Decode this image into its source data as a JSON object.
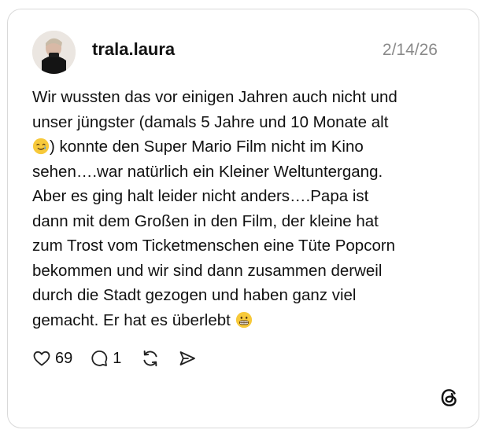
{
  "post": {
    "username": "trala.laura",
    "date": "2/14/26",
    "lines": [
      "Wir wussten das vor einigen Jahren auch nicht und",
      "unser jüngster (damals 5 Jahre und 10 Monate alt",
      ") konnte den Super Mario Film nicht im Kino",
      "sehen….war natürlich ein Kleiner Weltuntergang.",
      "Aber es ging halt leider nicht anders….Papa ist",
      "dann mit dem Großen in den Film, der kleine hat",
      "zum Trost vom Ticketmenschen eine Tüte Popcorn",
      "bekommen und wir sind dann zusammen derweil",
      "durch die Stadt gezogen und haben ganz viel",
      "gemacht. Er hat es überlebt"
    ],
    "emojis": [
      "smiling-face-with-tear-icon",
      "grimacing-face-icon"
    ]
  },
  "actions": {
    "like_count": "69",
    "reply_count": "1",
    "like_icon": "heart-icon",
    "reply_icon": "comment-icon",
    "repost_icon": "repost-icon",
    "share_icon": "send-icon"
  },
  "brand": {
    "icon": "threads-logo-icon"
  },
  "colors": {
    "text": "#111111",
    "muted": "#8a8a8a",
    "border": "#d9d9d9",
    "emoji": "#f7c93a"
  }
}
